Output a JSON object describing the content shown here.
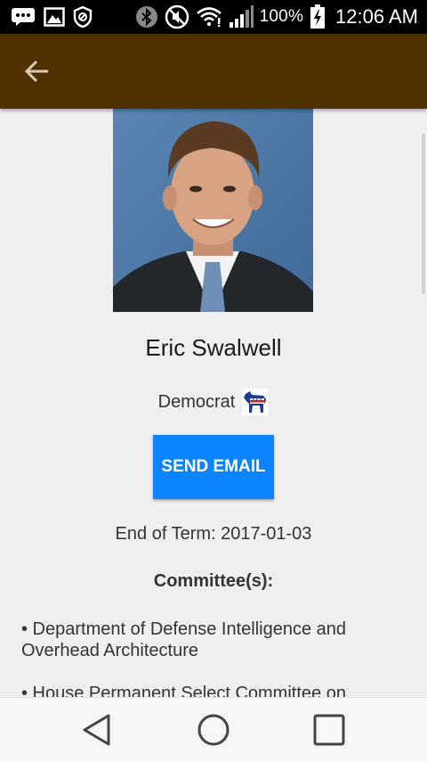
{
  "status_bar": {
    "battery_percent": "100%",
    "time": "12:06 AM",
    "icons": [
      "messaging-icon",
      "gallery-icon",
      "shield-icon",
      "bluetooth-icon",
      "mute-icon",
      "wifi-icon",
      "signal-icon",
      "battery-charging-icon"
    ]
  },
  "app_bar": {
    "back_icon": "back-arrow-icon",
    "color": "#4f3100"
  },
  "profile": {
    "portrait_icon": "portrait-photo",
    "name": "Eric Swalwell",
    "party": "Democrat",
    "party_logo": "democrat-donkey-icon",
    "send_email_label": "SEND EMAIL",
    "send_email_color": "#0a84ff",
    "end_of_term": "End of Term: 2017-01-03",
    "committees_heading": "Committee(s):",
    "committees": [
      "• Department of Defense Intelligence and Overhead Architecture",
      "• House Permanent Select Committee on"
    ]
  },
  "nav_bar": {
    "icons": [
      "back-triangle-icon",
      "home-circle-icon",
      "recents-square-icon"
    ]
  }
}
